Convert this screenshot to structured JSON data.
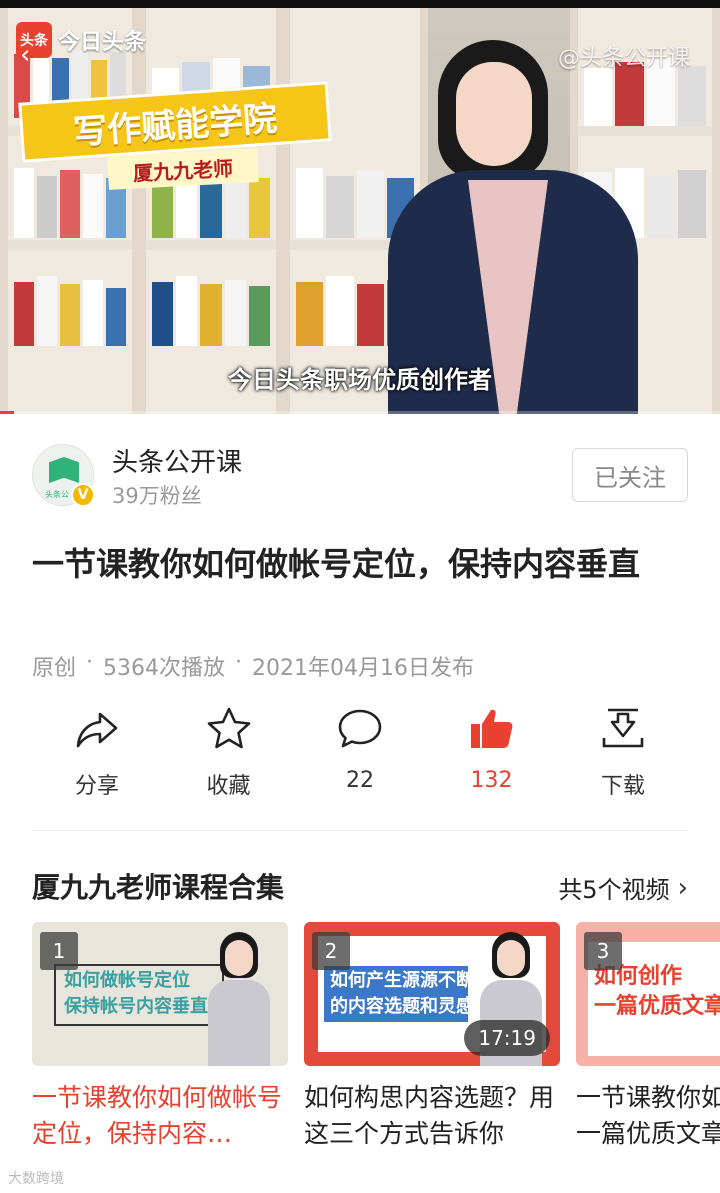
{
  "video": {
    "app_logo_mark": "头条",
    "app_logo_text": "今日头条",
    "watermark": "@头条公开课",
    "banner_title": "写作赋能学院",
    "banner_sub": "厦九九老师",
    "caption": "今日头条职场优质创作者",
    "progress": 0.02,
    "accent_color": "#e8412f"
  },
  "author": {
    "name": "头条公开课",
    "fans": "39万粉丝",
    "avatar_text": "头条公",
    "verified_badge": "V",
    "follow_label": "已关注"
  },
  "article": {
    "title": "一节课教你如何做帐号定位，保持内容垂直",
    "meta": {
      "type": "原创",
      "sep1": "·",
      "plays": "5364次播放",
      "sep2": "·",
      "date": "2021年04月16日发布"
    }
  },
  "actions": [
    {
      "label": "分享",
      "icon": "share-icon"
    },
    {
      "label": "收藏",
      "icon": "star-icon"
    },
    {
      "label": "22",
      "icon": "comment-icon"
    },
    {
      "label": "132",
      "icon": "thumbs-up-icon",
      "active": true
    },
    {
      "label": "下载",
      "icon": "download-icon"
    }
  ],
  "collection": {
    "title": "厦九九老师课程合集",
    "count_label": "共5个视频",
    "items": [
      {
        "index": "1",
        "thumb_text": "如何做帐号定位\n保持帐号内容垂直",
        "title": "一节课教你如何做帐号定位，保持内容…",
        "active": true
      },
      {
        "index": "2",
        "thumb_text": "如何产生源源不断\n的内容选题和灵感",
        "duration": "17:19",
        "title": "如何构思内容选题？用这三个方式告诉你"
      },
      {
        "index": "3",
        "thumb_text": "如何创作\n一篇优质文章",
        "title": "一节课教你如何创作出一篇优质文章"
      }
    ]
  },
  "footer": {
    "brand": "大数跨境"
  }
}
